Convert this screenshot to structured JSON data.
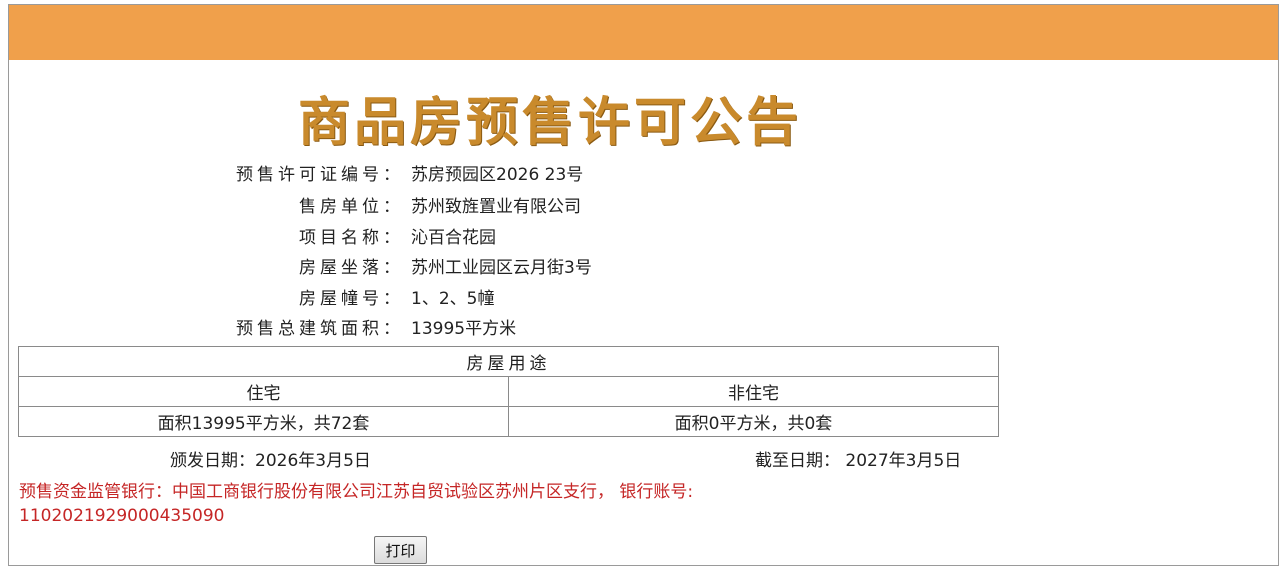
{
  "header": {
    "title": "商品房预售许可公告"
  },
  "fields": [
    {
      "label": "预售许可证编号：",
      "value": "苏房预园区2026 23号"
    },
    {
      "label": "售房单位：",
      "value": "苏州致旌置业有限公司"
    },
    {
      "label": "项目名称：",
      "value": "沁百合花园"
    },
    {
      "label": "房屋坐落：",
      "value": "苏州工业园区云月街3号"
    },
    {
      "label": "房屋幢号：",
      "value": "1、2、5幢"
    },
    {
      "label": "预售总建筑面积：",
      "value": "13995平方米"
    }
  ],
  "usage_table": {
    "caption": "房屋用途",
    "headers": [
      "住宅",
      "非住宅"
    ],
    "values": [
      "面积13995平方米，共72套",
      "面积0平方米，共0套"
    ]
  },
  "dates": {
    "issue": "颁发日期：2026年3月5日",
    "expiry": "截至日期：  2027年3月5日"
  },
  "bank": {
    "line1": "预售资金监管银行：中国工商银行股份有限公司江苏自贸试验区苏州片区支行，  银行账号:",
    "line2": "1102021929000435090"
  },
  "actions": {
    "print_label": "打印"
  },
  "colors": {
    "header_bar": "#f0a04b",
    "title": "#c98a2c",
    "bank_text": "#c52626"
  }
}
